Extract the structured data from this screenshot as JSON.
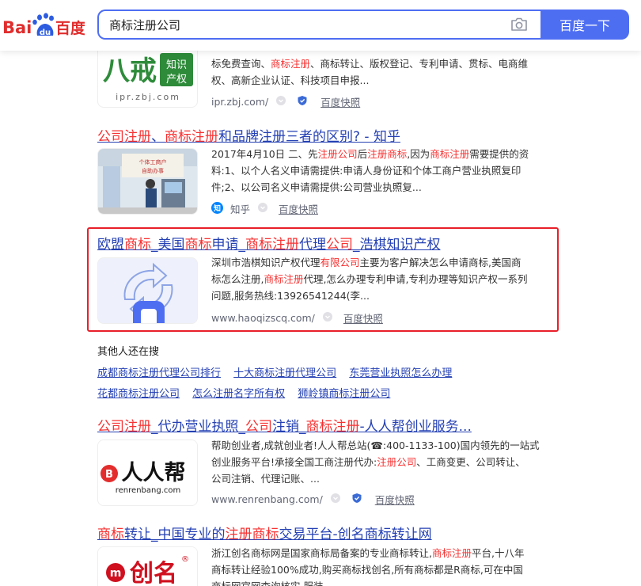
{
  "header": {
    "logo": {
      "bai": "Bai",
      "du": "du",
      "suffix": "百度"
    },
    "search_value": "商标注册公司",
    "search_button": "百度一下"
  },
  "colors": {
    "accent": "#4e6ef2",
    "link": "#2440b3",
    "highlight": "#f73131",
    "callout_border": "#e8202a"
  },
  "results": [
    {
      "id": "zbj",
      "title_parts": [],
      "desc_lines": [
        [
          {
            "t": "标免费查询、",
            "hl": false
          },
          {
            "t": "商标注册",
            "hl": true
          },
          {
            "t": "、商标转让、版权登记、专利申请、贯标、电商维",
            "hl": false
          }
        ],
        [
          {
            "t": "权、高新企业认证、科技项目申报...",
            "hl": false
          }
        ]
      ],
      "site": "ipr.zbj.com/",
      "kuaizhao": "百度快照",
      "thumb_text": {
        "big": "八戒",
        "side": "知识产权",
        "url": "ipr.zbj.com"
      }
    },
    {
      "id": "zhihu",
      "title_parts": [
        {
          "t": "公司注册",
          "hl": true
        },
        {
          "t": "、",
          "hl": false
        },
        {
          "t": "商标注册",
          "hl": true
        },
        {
          "t": "和品牌注册三者的区别? - 知乎",
          "hl": false
        }
      ],
      "desc_lines": [
        [
          {
            "t": "2017年4月10日 二、先",
            "hl": false
          },
          {
            "t": "注册公司",
            "hl": true
          },
          {
            "t": "后",
            "hl": false
          },
          {
            "t": "注册商标",
            "hl": true
          },
          {
            "t": ",因为",
            "hl": false
          },
          {
            "t": "商标注册",
            "hl": true
          },
          {
            "t": "需要提供的资",
            "hl": false
          }
        ],
        [
          {
            "t": "料:1、以个人名义申请需提供:申请人身份证和个体工商户营业执照复印",
            "hl": false
          }
        ],
        [
          {
            "t": "件;2、以公司名义申请需提供:公司营业执照复...",
            "hl": false
          }
        ]
      ],
      "site": "知乎",
      "kuaizhao": "百度快照",
      "thumb_text": {
        "sign": "个体工商户 自助办事"
      }
    },
    {
      "id": "haoqi",
      "title_parts": [
        {
          "t": "欧盟",
          "hl": false
        },
        {
          "t": "商标",
          "hl": true
        },
        {
          "t": "_美国",
          "hl": false
        },
        {
          "t": "商标",
          "hl": true
        },
        {
          "t": "申请_",
          "hl": false
        },
        {
          "t": "商标注册",
          "hl": true
        },
        {
          "t": "代理",
          "hl": false
        },
        {
          "t": "公司",
          "hl": true
        },
        {
          "t": "_浩棋知识产权",
          "hl": false
        }
      ],
      "desc_lines": [
        [
          {
            "t": "深圳市浩棋知识产权代理",
            "hl": false
          },
          {
            "t": "有限公司",
            "hl": true
          },
          {
            "t": "主要为客户解决怎么申请商标,美国商",
            "hl": false
          }
        ],
        [
          {
            "t": "标怎么注册,",
            "hl": false
          },
          {
            "t": "商标注册",
            "hl": true
          },
          {
            "t": "代理,怎么办理专利申请,专利办理等知识产权一系列",
            "hl": false
          }
        ],
        [
          {
            "t": "问题,服务热线:13926541244(李...",
            "hl": false
          }
        ]
      ],
      "site": "www.haoqizscq.com/",
      "kuaizhao": "百度快照"
    },
    {
      "id": "renrenbang",
      "title_parts": [
        {
          "t": "公司注册",
          "hl": true
        },
        {
          "t": "_代办营业执照_",
          "hl": false
        },
        {
          "t": "公司",
          "hl": true
        },
        {
          "t": "注销_",
          "hl": false
        },
        {
          "t": "商标注册",
          "hl": true
        },
        {
          "t": "-人人帮创业服务...",
          "hl": false
        }
      ],
      "desc_lines": [
        [
          {
            "t": "帮助创业者,成就创业者!人人帮总站(☎:400-1133-100)国内领先的一站式",
            "hl": false
          }
        ],
        [
          {
            "t": "创业服务平台!承接全国工商注册代办:",
            "hl": false
          },
          {
            "t": "注册公司",
            "hl": true
          },
          {
            "t": "、工商变更、公司转让、",
            "hl": false
          }
        ],
        [
          {
            "t": "公司注销、代理记账、...",
            "hl": false
          }
        ]
      ],
      "site": "www.renrenbang.com/",
      "kuaizhao": "百度快照",
      "thumb_text": {
        "brand": "人人帮",
        "url": "renrenbang.com"
      }
    },
    {
      "id": "chuangming",
      "title_parts": [
        {
          "t": "商标",
          "hl": true
        },
        {
          "t": "转让_中国专业的",
          "hl": false
        },
        {
          "t": "注册商标",
          "hl": true
        },
        {
          "t": "交易平台-创名商标转让网",
          "hl": false
        }
      ],
      "desc_lines": [
        [
          {
            "t": "浙江创名商标网是国家商标局备案的专业商标转让,",
            "hl": false
          },
          {
            "t": "商标注册",
            "hl": true
          },
          {
            "t": "平台,十八年",
            "hl": false
          }
        ],
        [
          {
            "t": "商标转让经验100%成功,购买商标找创名,所有商标都是R商标,可在中国",
            "hl": false
          }
        ],
        [
          {
            "t": "商标网官网查询核实,服装...",
            "hl": false
          }
        ]
      ],
      "thumb_text": {
        "brand": "创名"
      }
    }
  ],
  "others_search": {
    "title": "其他人还在搜",
    "rows": [
      [
        "成都商标注册代理公司排行",
        "十大商标注册代理公司",
        "东莞营业执照怎么办理"
      ],
      [
        "花都商标注册公司",
        "怎么注册名字所有权",
        "狮岭镇商标注册公司"
      ]
    ]
  }
}
